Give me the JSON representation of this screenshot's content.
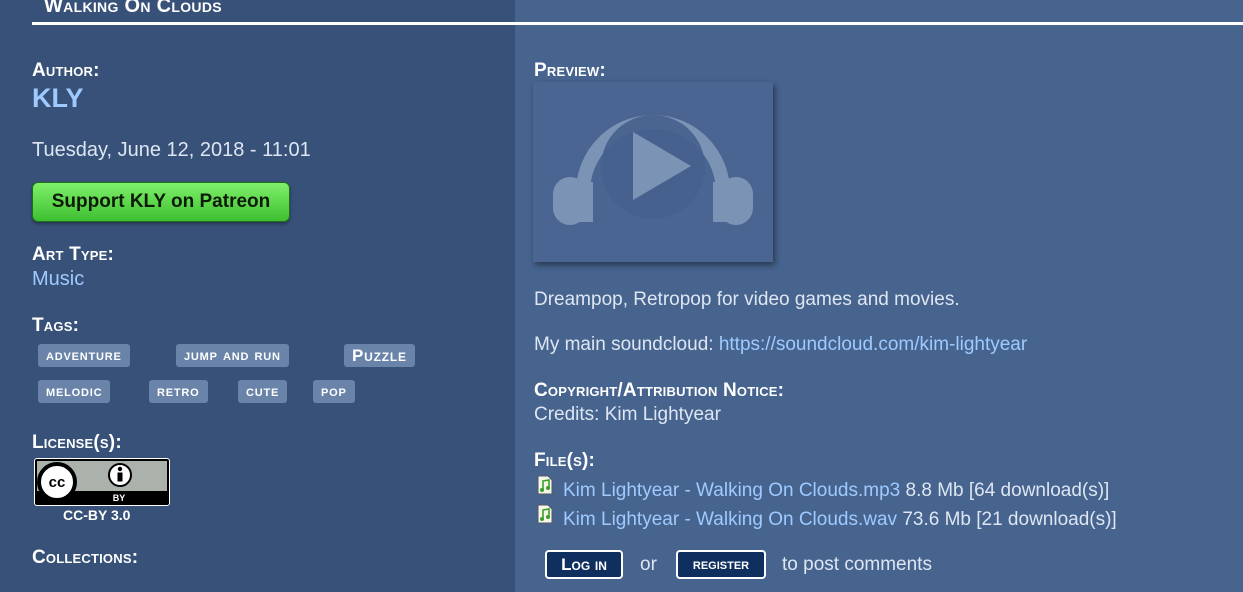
{
  "page": {
    "title": "Walking On Clouds"
  },
  "left": {
    "author_heading": "Author:",
    "author_name": "KLY",
    "date": "Tuesday, June 12, 2018 - 11:01",
    "patreon_label": "Support KLY on Patreon",
    "art_type_heading": "Art Type:",
    "art_type": "Music",
    "tags_heading": "Tags:",
    "tags": [
      "adventure",
      "jump and run",
      "Puzzle",
      "melodic",
      "retro",
      "cute",
      "pop"
    ],
    "license_heading": "License(s):",
    "license_badge": {
      "cc": "cc",
      "by": "BY"
    },
    "license_name": "CC-BY 3.0",
    "collections_heading": "Collections:"
  },
  "right": {
    "preview_heading": "Preview:",
    "description": "Dreampop, Retropop for video games and movies.",
    "soundcloud_prefix": "My main soundcloud:",
    "soundcloud_link": "https://soundcloud.com/kim-lightyear",
    "copyright_heading": "Copyright/Attribution Notice:",
    "credits": "Credits: Kim Lightyear",
    "files_heading": "File(s):",
    "files": [
      {
        "name": "Kim Lightyear - Walking On Clouds.mp3",
        "info": "8.8 Mb [64 download(s)]",
        "icon": "audio-file-icon"
      },
      {
        "name": "Kim Lightyear - Walking On Clouds.wav",
        "info": "73.6 Mb [21 download(s)]",
        "icon": "audio-file-icon"
      }
    ],
    "login_label": "Log in",
    "or_text": "or",
    "register_label": "register",
    "post_comments_text": "to post comments"
  },
  "colors": {
    "left_bg": "#385178",
    "right_bg": "#47648f",
    "link": "#9fcaff",
    "tag_bg": "#6983a9",
    "patreon_green": "#4fd23c",
    "button_bg": "#0f2f5e"
  }
}
